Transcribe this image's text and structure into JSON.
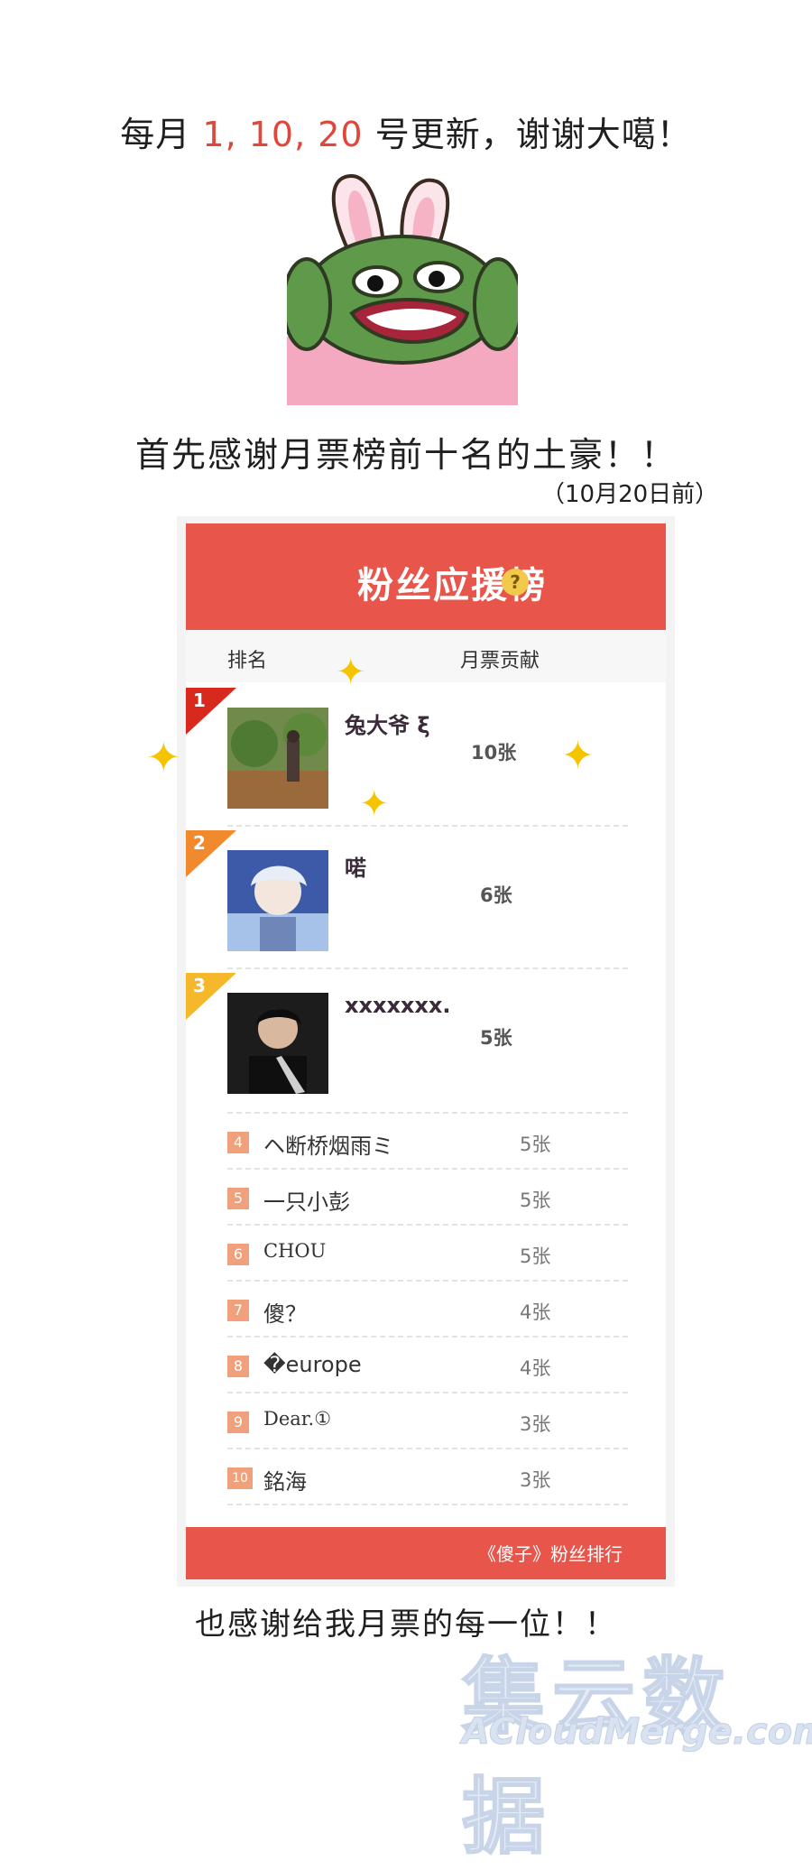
{
  "header": {
    "update_prefix": "每月",
    "update_days": "1, 10, 20",
    "update_suffix": "号更新，谢谢大噶！"
  },
  "meme": {
    "icon": "bunny-ear-frog-icon"
  },
  "thanks_top": "首先感谢月票榜前十名的土豪！！",
  "date_note": "（10月20日前）",
  "board": {
    "title": "粉丝应援榜",
    "help_symbol": "?",
    "col_rank": "排名",
    "col_votes": "月票贡献",
    "top3": [
      {
        "rank": "1",
        "name": "兔大爷 ξ",
        "votes": "10张",
        "ribbon_color": "#d8291f"
      },
      {
        "rank": "2",
        "name": "喏",
        "votes": "6张",
        "ribbon_color": "#f08a2c"
      },
      {
        "rank": "3",
        "name": "xxxxxxx.",
        "votes": "5张",
        "ribbon_color": "#f5b82a"
      }
    ],
    "rows": [
      {
        "rank": "4",
        "name": "ヘ断桥烟雨ミ",
        "votes": "5张"
      },
      {
        "rank": "5",
        "name": "一只小彭",
        "votes": "5张"
      },
      {
        "rank": "6",
        "name": "CHOU",
        "votes": "5张"
      },
      {
        "rank": "7",
        "name": "傻？",
        "votes": "4张"
      },
      {
        "rank": "8",
        "name": "�europe",
        "votes": "4张"
      },
      {
        "rank": "9",
        "name": "Dear.①",
        "votes": "3张"
      },
      {
        "rank": "10",
        "name": "銘海",
        "votes": "3张"
      }
    ],
    "footer": "《傻子》粉丝排行",
    "accent": "#e8554a"
  },
  "thanks_bottom": "也感谢给我月票的每一位！！",
  "watermark": {
    "cn": "集云数据",
    "en": "ACloudMerge.com"
  }
}
